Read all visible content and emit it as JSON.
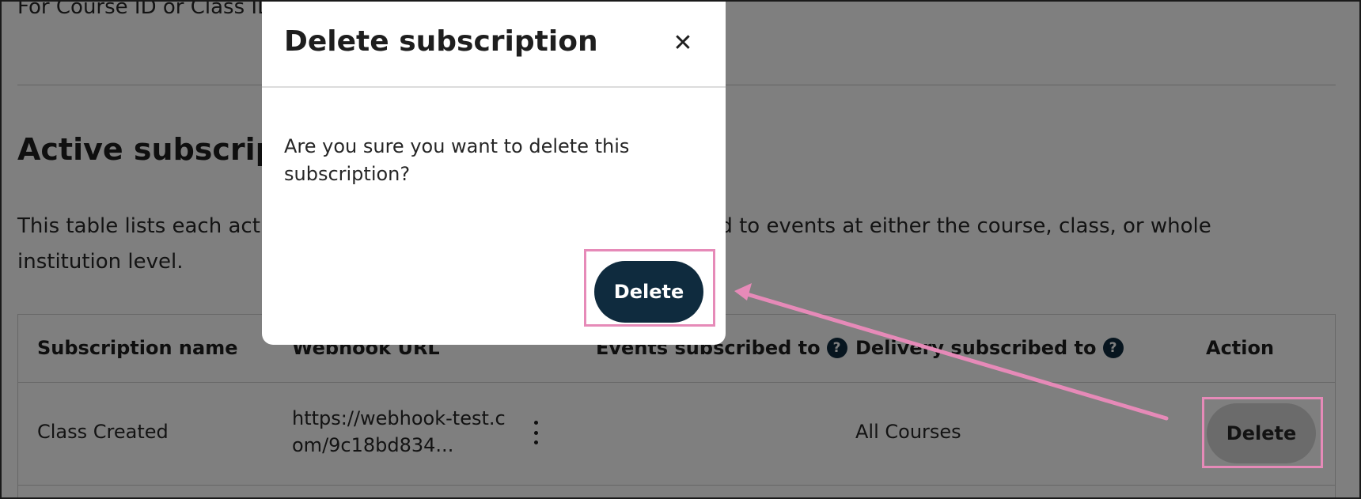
{
  "page": {
    "cut_label": "For Course ID or Class ID",
    "section_title": "Active subscriptions",
    "section_description": "This table lists each active subscription. Subscriptions are subscribed to events at either the course, class, or whole institution level."
  },
  "table": {
    "headers": {
      "name": "Subscription name",
      "url": "Webhook URL",
      "events": "Events subscribed to",
      "delivery": "Delivery subscribed to",
      "action": "Action"
    },
    "help_glyph": "?",
    "row": {
      "name": "Class Created",
      "url": "https://webhook-test.com/9c18bd834...",
      "events": "",
      "delivery": "All Courses",
      "action_label": "Delete"
    }
  },
  "modal": {
    "title": "Delete subscription",
    "close_glyph": "✕",
    "message": "Are you sure you want to delete this subscription?",
    "confirm_label": "Delete"
  },
  "colors": {
    "primary_button": "#0f2b3e",
    "highlight": "#e68ab8",
    "overlay": "rgba(0,0,0,0.5)"
  },
  "icons": [
    "help-icon",
    "close-icon",
    "kebab-menu-icon",
    "annotation-arrow"
  ]
}
